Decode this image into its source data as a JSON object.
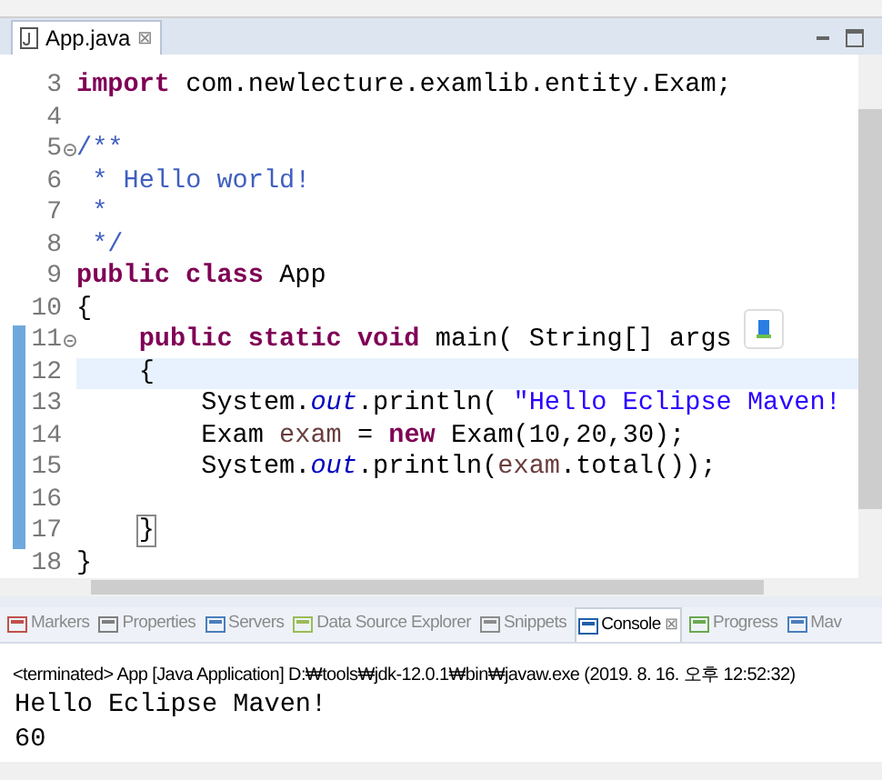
{
  "editor": {
    "tab": {
      "title": "App.java",
      "close": "⊠",
      "selected": true
    },
    "lines": [
      {
        "number": "3",
        "changed": false,
        "current": false,
        "foldable": false,
        "tokens": [
          {
            "kind": "keyword",
            "text": "import"
          },
          {
            "kind": "plain",
            "text": " com.newlecture.examlib.entity.Exam;"
          }
        ]
      },
      {
        "number": "4",
        "changed": false,
        "current": false,
        "foldable": false
      },
      {
        "number": "5",
        "changed": false,
        "current": false,
        "foldable": true,
        "tokens": [
          {
            "kind": "comment",
            "text": "/**"
          }
        ]
      },
      {
        "number": "6",
        "changed": false,
        "current": false,
        "foldable": false,
        "tokens": [
          {
            "kind": "comment",
            "text": " * Hello world!"
          }
        ]
      },
      {
        "number": "7",
        "changed": false,
        "current": false,
        "foldable": false,
        "tokens": [
          {
            "kind": "comment",
            "text": " *"
          }
        ]
      },
      {
        "number": "8",
        "changed": false,
        "current": false,
        "foldable": false,
        "tokens": [
          {
            "kind": "comment",
            "text": " */"
          }
        ]
      },
      {
        "number": "9",
        "changed": false,
        "current": false,
        "foldable": false,
        "tokens": [
          {
            "kind": "keyword",
            "text": "public class"
          },
          {
            "kind": "plain",
            "text": " App"
          }
        ]
      },
      {
        "number": "10",
        "changed": false,
        "current": false,
        "foldable": false,
        "tokens": [
          {
            "kind": "plain",
            "text": "{"
          }
        ]
      },
      {
        "number": "11",
        "changed": true,
        "current": false,
        "foldable": true,
        "tokens": [
          {
            "kind": "keyword",
            "text": "    public static void"
          },
          {
            "kind": "plain",
            "text": " main( String[] args"
          }
        ]
      },
      {
        "number": "12",
        "changed": true,
        "current": true,
        "foldable": false,
        "tokens": [
          {
            "kind": "plain",
            "text": "    {"
          }
        ]
      },
      {
        "number": "13",
        "changed": true,
        "current": false,
        "foldable": false,
        "tokens": [
          {
            "kind": "plain",
            "text": "        System."
          },
          {
            "kind": "field",
            "text": "out"
          },
          {
            "kind": "plain",
            "text": ".println( "
          },
          {
            "kind": "string",
            "text": "\"Hello Eclipse Maven!"
          }
        ]
      },
      {
        "number": "14",
        "changed": true,
        "current": false,
        "foldable": false,
        "tokens": [
          {
            "kind": "plain",
            "text": "        Exam "
          },
          {
            "kind": "variable",
            "text": "exam"
          },
          {
            "kind": "plain",
            "text": " = "
          },
          {
            "kind": "keyword",
            "text": "new"
          },
          {
            "kind": "plain",
            "text": " Exam(10,20,30);"
          }
        ]
      },
      {
        "number": "15",
        "changed": true,
        "current": false,
        "foldable": false,
        "tokens": [
          {
            "kind": "plain",
            "text": "        System."
          },
          {
            "kind": "field",
            "text": "out"
          },
          {
            "kind": "plain",
            "text": ".println("
          },
          {
            "kind": "variable",
            "text": "exam"
          },
          {
            "kind": "plain",
            "text": ".total());"
          }
        ]
      },
      {
        "number": "16",
        "changed": true,
        "current": false,
        "foldable": false
      },
      {
        "number": "17",
        "changed": true,
        "current": false,
        "foldable": false,
        "tokens": [
          {
            "kind": "bracket",
            "text": "    }"
          }
        ]
      },
      {
        "number": "18",
        "changed": false,
        "current": false,
        "foldable": false,
        "tokens": [
          {
            "kind": "plain",
            "text": "}"
          }
        ]
      }
    ]
  },
  "panel": {
    "tabs": [
      {
        "label": "Markers",
        "selected": false
      },
      {
        "label": "Properties",
        "selected": false
      },
      {
        "label": "Servers",
        "selected": false
      },
      {
        "label": "Data Source Explorer",
        "selected": false
      },
      {
        "label": "Snippets",
        "selected": false
      },
      {
        "label": "Console",
        "selected": true,
        "close": "⊠"
      },
      {
        "label": "Progress",
        "selected": false
      },
      {
        "label": "Mav",
        "selected": false
      }
    ],
    "status": "<terminated> App [Java Application] D:₩tools₩jdk-12.0.1₩bin₩javaw.exe (2019. 8. 16. 오후 12:52:32)",
    "output": [
      "Hello Eclipse Maven!",
      "60"
    ]
  }
}
